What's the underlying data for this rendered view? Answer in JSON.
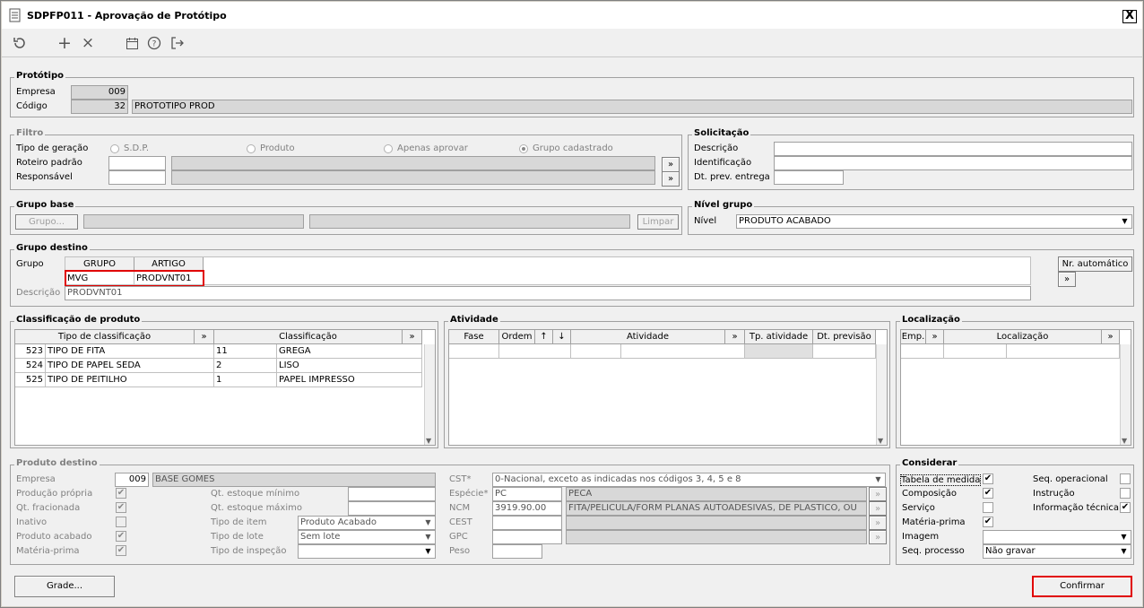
{
  "window": {
    "title": "SDPFP011 - Aprovação de Protótipo",
    "close": "X"
  },
  "toolbar": {
    "refresh_icon": "refresh-icon",
    "add_icon": "plus-icon",
    "cancel_icon": "x-icon",
    "calendar_icon": "calendar-icon",
    "help_icon": "help-icon",
    "exit_icon": "exit-icon"
  },
  "prototipo": {
    "title": "Protótipo",
    "empresa_label": "Empresa",
    "empresa_value": "009",
    "codigo_label": "Código",
    "codigo_value": "32",
    "codigo_desc": "PROTOTIPO PROD"
  },
  "filtro": {
    "title": "Filtro",
    "tipo_label": "Tipo de geração",
    "opt_sdp": "S.D.P.",
    "opt_produto": "Produto",
    "opt_aprovar": "Apenas aprovar",
    "opt_grupo": "Grupo cadastrado",
    "roteiro_label": "Roteiro padrão",
    "responsavel_label": "Responsável",
    "more": "»"
  },
  "solicitacao": {
    "title": "Solicitação",
    "descricao_label": "Descrição",
    "identificacao_label": "Identificação",
    "dt_label": "Dt. prev. entrega"
  },
  "grupo_base": {
    "title": "Grupo base",
    "grupo_btn": "Grupo...",
    "limpar_btn": "Limpar"
  },
  "nivel_grupo": {
    "title": "Nível grupo",
    "nivel_label": "Nível",
    "nivel_value": "PRODUTO ACABADO"
  },
  "grupo_destino": {
    "title": "Grupo destino",
    "grupo_label": "Grupo",
    "col_grupo": "GRUPO",
    "col_artigo": "ARTIGO",
    "grupo_value": "MVG",
    "artigo_value": "PRODVNT01",
    "descricao_label": "Descrição",
    "descricao_value": "PRODVNT01",
    "nr_auto_btn": "Nr. automático",
    "more": "»"
  },
  "classificacao": {
    "title": "Classificação de produto",
    "col_tipo": "Tipo de classificação",
    "col_class": "Classificação",
    "more": "»",
    "rows": [
      {
        "code": "523",
        "tipo": "TIPO DE FITA",
        "num": "11",
        "class": "GREGA"
      },
      {
        "code": "524",
        "tipo": "TIPO DE PAPEL SEDA",
        "num": "2",
        "class": "LISO"
      },
      {
        "code": "525",
        "tipo": "TIPO DE PEITILHO",
        "num": "1",
        "class": "PAPEL IMPRESSO"
      }
    ]
  },
  "atividade": {
    "title": "Atividade",
    "col_fase": "Fase",
    "col_ordem": "Ordem",
    "up": "↑",
    "down": "↓",
    "col_atividade": "Atividade",
    "col_tp": "Tp. atividade",
    "col_dt": "Dt. previsão",
    "more": "»"
  },
  "localizacao": {
    "title": "Localização",
    "col_emp": "Emp.",
    "col_loc": "Localização",
    "more": "»"
  },
  "produto_destino": {
    "title": "Produto destino",
    "empresa_label": "Empresa",
    "empresa_value": "009",
    "empresa_desc": "BASE GOMES",
    "producao_label": "Produção própria",
    "fracionada_label": "Qt. fracionada",
    "inativo_label": "Inativo",
    "acabado_label": "Produto acabado",
    "materia_label": "Matéria-prima",
    "est_min_label": "Qt. estoque mínimo",
    "est_max_label": "Qt. estoque máximo",
    "tipo_item_label": "Tipo de item",
    "tipo_item_value": "Produto Acabado",
    "tipo_lote_label": "Tipo de lote",
    "tipo_lote_value": "Sem lote",
    "tipo_insp_label": "Tipo de inspeção",
    "cst_label": "CST*",
    "cst_value": "0-Nacional, exceto as indicadas nos códigos 3, 4, 5 e 8",
    "especie_label": "Espécie*",
    "especie_code": "PC",
    "especie_desc": "PECA",
    "ncm_label": "NCM",
    "ncm_code": "3919.90.00",
    "ncm_desc": "FITA/PELICULA/FORM PLANAS AUTOADESIVAS, DE PLASTICO, OU",
    "cest_label": "CEST",
    "gpc_label": "GPC",
    "peso_label": "Peso"
  },
  "considerar": {
    "title": "Considerar",
    "tabela_label": "Tabela de medida",
    "composicao_label": "Composição",
    "servico_label": "Serviço",
    "materia_label": "Matéria-prima",
    "imagem_label": "Imagem",
    "seq_proc_label": "Seq. processo",
    "seq_proc_value": "Não gravar",
    "seq_op_label": "Seq. operacional",
    "instrucao_label": "Instrução",
    "info_tec_label": "Informação técnica",
    "check": "✔"
  },
  "footer": {
    "grade_btn": "Grade...",
    "confirmar_btn": "Confirmar"
  }
}
